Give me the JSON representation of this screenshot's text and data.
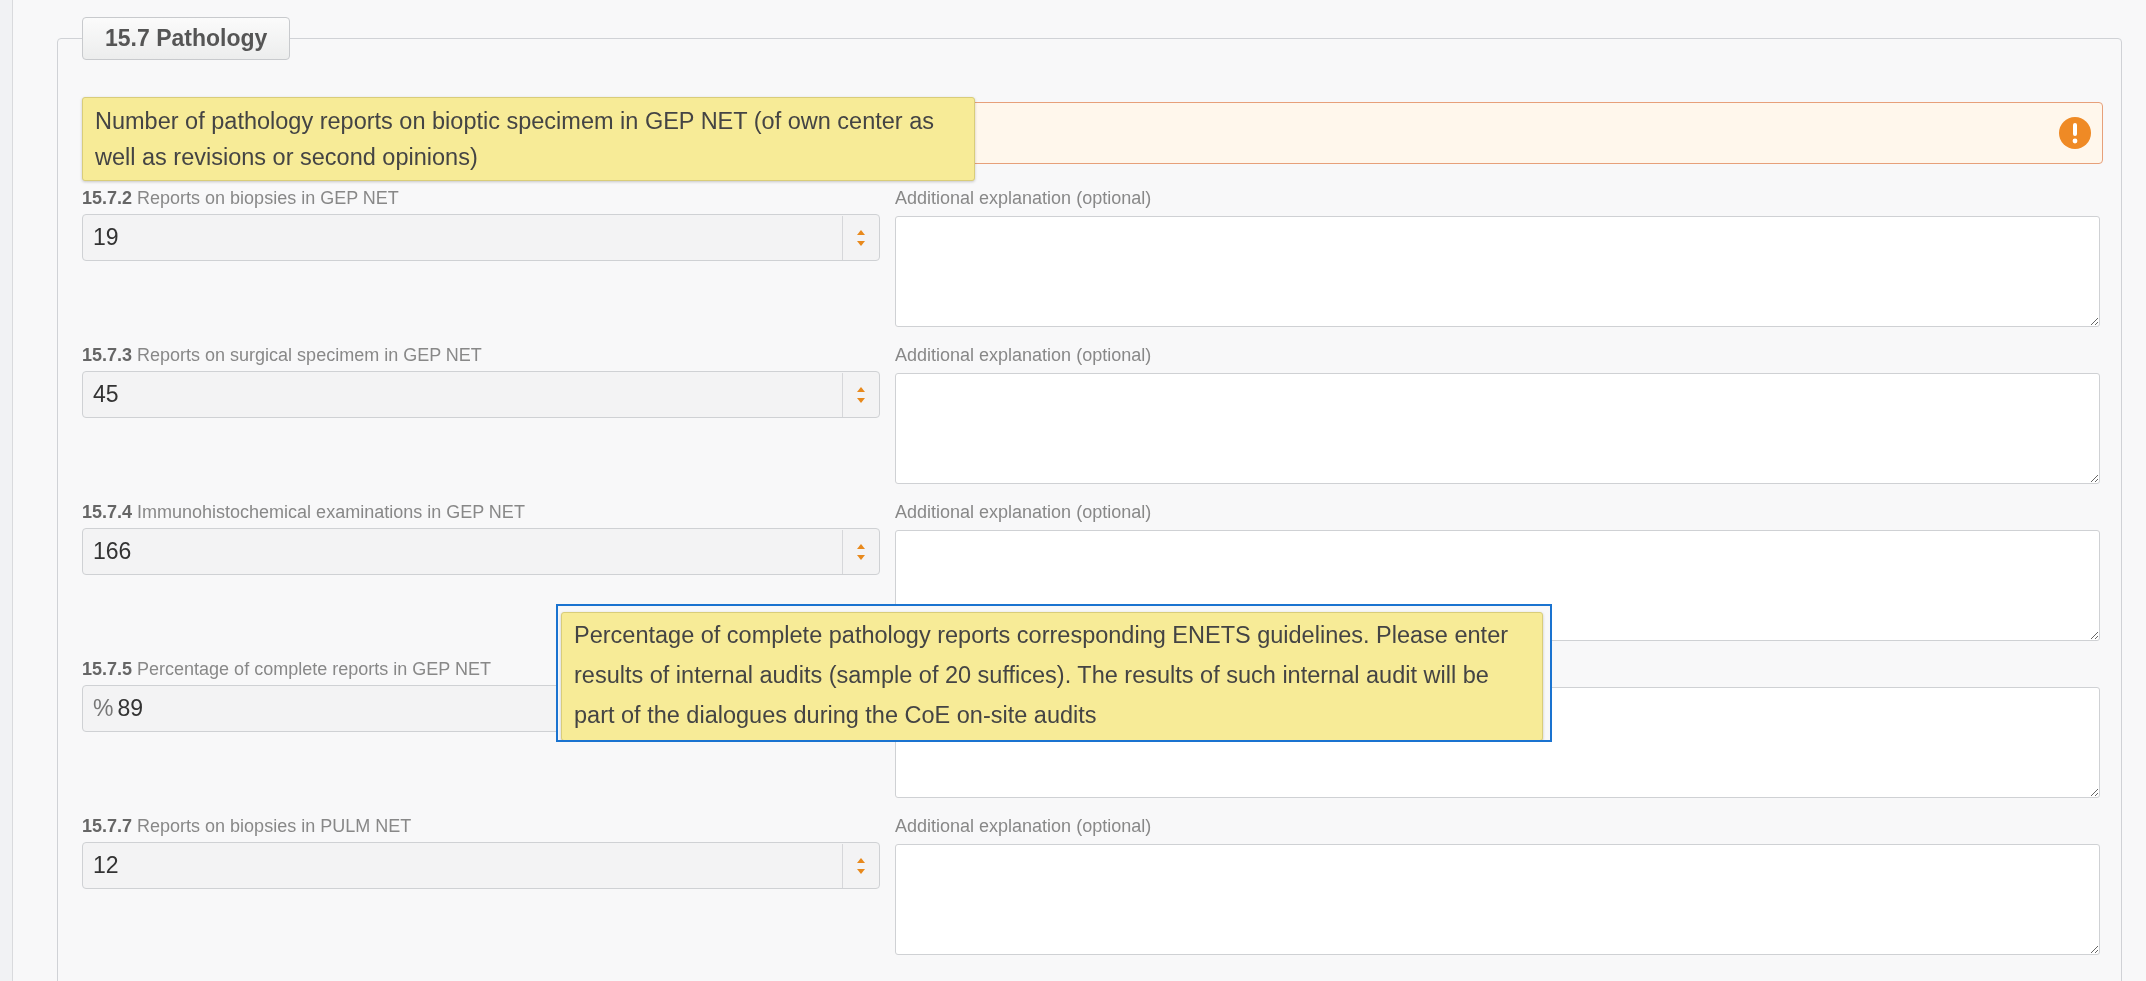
{
  "section": {
    "title": "15.7 Pathology"
  },
  "tooltips": [
    {
      "text": "Number of pathology reports on bioptic specimem in GEP NET (of own center as well as revisions or second opinions)"
    },
    {
      "text": "Percentage of complete pathology reports corresponding ENETS guidelines. Please enter results of internal audits (sample of 20 suffices). The results of such internal audit will be part of the dialogues during the CoE on-site audits"
    }
  ],
  "rows": [
    {
      "number": "15.7.2",
      "label": "Reports on biopsies in GEP NET",
      "kind": "number",
      "value": "19",
      "explanation_label": "Additional explanation (optional)"
    },
    {
      "number": "15.7.3",
      "label": "Reports on surgical specimem in GEP NET",
      "kind": "number",
      "value": "45",
      "explanation_label": "Additional explanation (optional)"
    },
    {
      "number": "15.7.4",
      "label": "Immunohistochemical examinations in GEP NET",
      "kind": "number",
      "value": "166",
      "explanation_label": "Additional explanation (optional)"
    },
    {
      "number": "15.7.5",
      "label": "Percentage of complete reports in GEP NET",
      "kind": "percent",
      "prefix": "%",
      "value": "89"
    },
    {
      "number": "15.7.7",
      "label": "Reports on biopsies in PULM NET",
      "kind": "number",
      "value": "12",
      "explanation_label": "Additional explanation (optional)"
    }
  ]
}
